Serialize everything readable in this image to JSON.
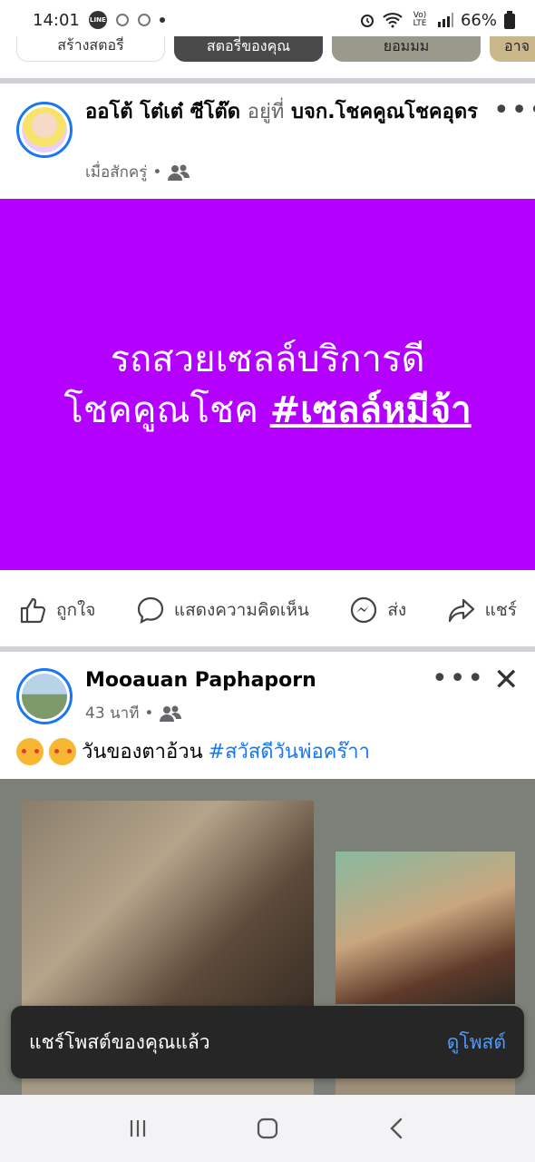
{
  "status_bar": {
    "time": "14:01",
    "line_label": "LINE",
    "volte": "Vo) LTE",
    "battery": "66%"
  },
  "stories": [
    "สร้างสตอรี่",
    "สตอรี่ของคุณ",
    "ยอมมม",
    "อาจ"
  ],
  "post1": {
    "author": "ออโต้ โต๋เต๋ ซีโต๊ด",
    "at_word": "อยู่ที่",
    "place": "บจก.โชคคูณโชคอุดร",
    "time": "เมื่อสักครู่",
    "dot": "•",
    "more": "•••",
    "text_line1": "รถสวยเซลล์บริการดี",
    "text_line2_prefix": "โชคคูณโชค ",
    "hashtag": "#เซลล์หมีจ้า"
  },
  "actions": {
    "like": "ถูกใจ",
    "comment": "แสดงความคิดเห็น",
    "send": "ส่ง",
    "share": "แชร์"
  },
  "post2": {
    "author": "Mooauan Paphaporn",
    "time": "43 นาที",
    "dot": "•",
    "more": "•••",
    "close": "✕",
    "caption": "วันของตาอ้วน",
    "hashtag": "#สวัสดีวันพ่อคร๊าา"
  },
  "toast": {
    "message": "แชร์โพสต์ของคุณแล้ว",
    "link": "ดูโพสต์"
  },
  "colors": {
    "post_bg": "#b300ff",
    "accent": "#1877f2"
  }
}
